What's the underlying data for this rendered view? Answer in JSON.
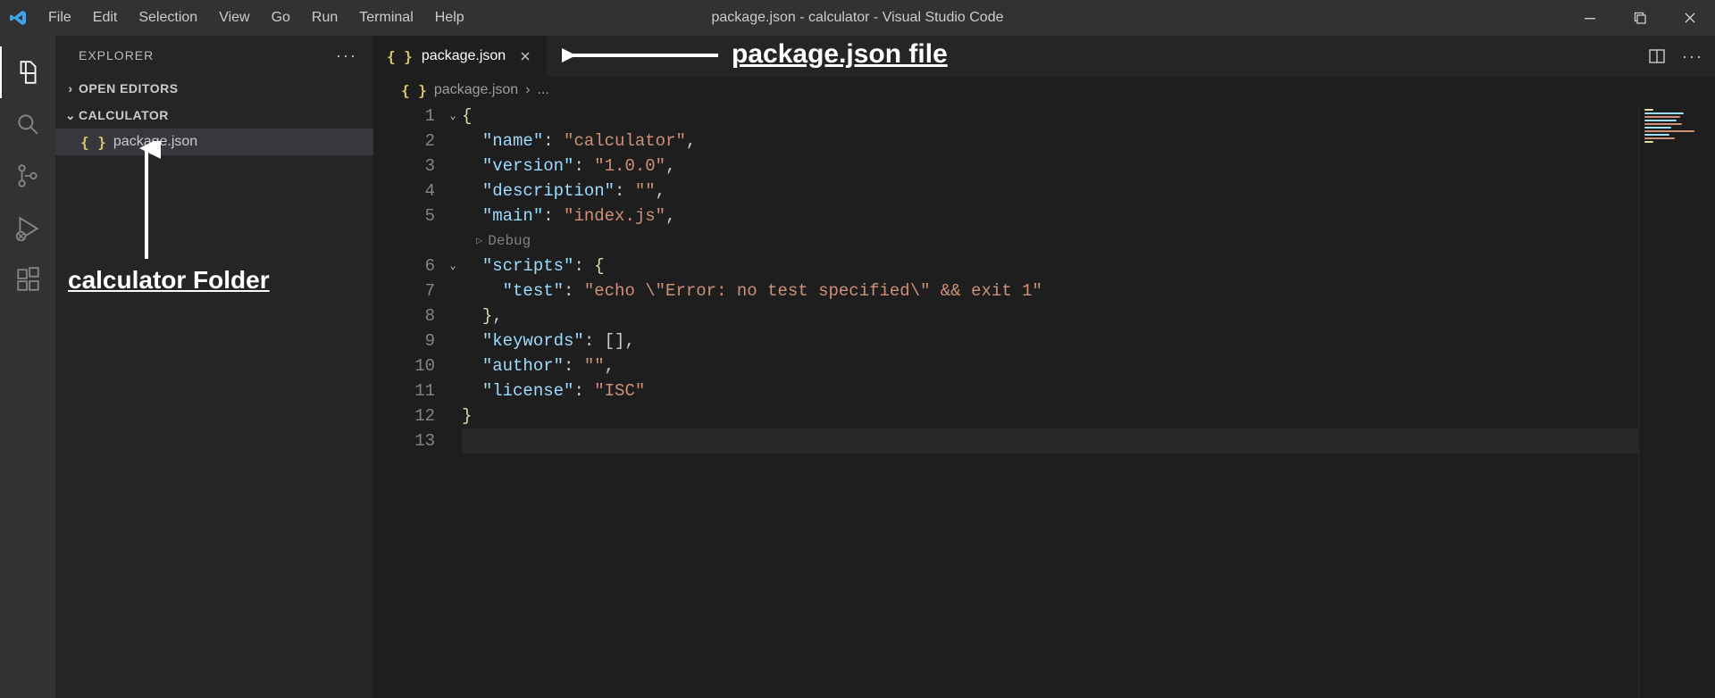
{
  "window": {
    "title": "package.json - calculator - Visual Studio Code"
  },
  "menu": [
    "File",
    "Edit",
    "Selection",
    "View",
    "Go",
    "Run",
    "Terminal",
    "Help"
  ],
  "activity": [
    {
      "name": "explorer",
      "active": true,
      "icon": "files-icon"
    },
    {
      "name": "search",
      "active": false,
      "icon": "search-icon"
    },
    {
      "name": "source-control",
      "active": false,
      "icon": "git-icon"
    },
    {
      "name": "run-debug",
      "active": false,
      "icon": "debug-icon"
    },
    {
      "name": "extensions",
      "active": false,
      "icon": "extensions-icon"
    }
  ],
  "explorer": {
    "title": "EXPLORER",
    "sections": {
      "openEditors": {
        "label": "OPEN EDITORS",
        "collapsed": true
      },
      "folder": {
        "label": "CALCULATOR",
        "collapsed": false
      }
    },
    "files": [
      {
        "name": "package.json",
        "iconGlyph": "{ }"
      }
    ]
  },
  "tabs": [
    {
      "name": "package.json",
      "iconGlyph": "{ }",
      "active": true
    }
  ],
  "breadcrumb": {
    "iconGlyph": "{ }",
    "file": "package.json",
    "tail": "..."
  },
  "code": {
    "debugLens": "Debug",
    "lines": [
      {
        "n": 1,
        "fold": "v",
        "kind": "open",
        "indent": 0
      },
      {
        "n": 2,
        "fold": "",
        "kind": "kv",
        "indent": 1,
        "keyText": "\"name\"",
        "valueText": "\"calculator\"",
        "trailing": ","
      },
      {
        "n": 3,
        "fold": "",
        "kind": "kv",
        "indent": 1,
        "keyText": "\"version\"",
        "valueText": "\"1.0.0\"",
        "trailing": ","
      },
      {
        "n": 4,
        "fold": "",
        "kind": "kv",
        "indent": 1,
        "keyText": "\"description\"",
        "valueText": "\"\"",
        "trailing": ","
      },
      {
        "n": 5,
        "fold": "",
        "kind": "kv",
        "indent": 1,
        "keyText": "\"main\"",
        "valueText": "\"index.js\"",
        "trailing": ","
      },
      {
        "n": "",
        "fold": "",
        "kind": "lens"
      },
      {
        "n": 6,
        "fold": "v",
        "kind": "kobj",
        "indent": 1,
        "keyText": "\"scripts\""
      },
      {
        "n": 7,
        "fold": "",
        "kind": "kv",
        "indent": 2,
        "keyText": "\"test\"",
        "valueText": "\"echo \\\"Error: no test specified\\\" && exit 1\"",
        "trailing": ""
      },
      {
        "n": 8,
        "fold": "",
        "kind": "closeobj",
        "indent": 1,
        "trailing": ","
      },
      {
        "n": 9,
        "fold": "",
        "kind": "karr",
        "indent": 1,
        "keyText": "\"keywords\"",
        "trailing": ","
      },
      {
        "n": 10,
        "fold": "",
        "kind": "kv",
        "indent": 1,
        "keyText": "\"author\"",
        "valueText": "\"\"",
        "trailing": ","
      },
      {
        "n": 11,
        "fold": "",
        "kind": "kv",
        "indent": 1,
        "keyText": "\"license\"",
        "valueText": "\"ISC\"",
        "trailing": ""
      },
      {
        "n": 12,
        "fold": "",
        "kind": "close",
        "indent": 0
      },
      {
        "n": 13,
        "fold": "",
        "kind": "blank",
        "current": true
      }
    ]
  },
  "annotations": {
    "fileLabel": "package.json file",
    "folderLabel": "calculator Folder"
  },
  "icons": {
    "minimize": "—",
    "maximize": "☐",
    "close": "✕",
    "ellipsis": "···",
    "chevRight": "›",
    "chevDown": "⌄"
  }
}
